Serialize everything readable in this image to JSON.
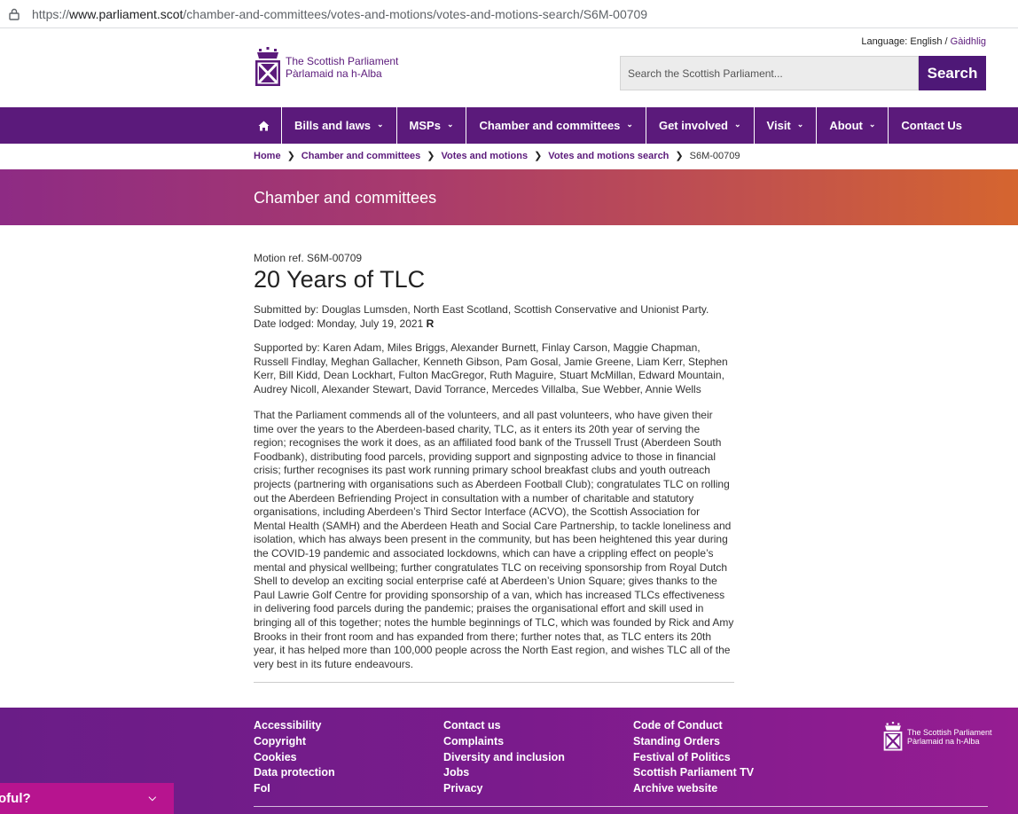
{
  "browser": {
    "url_prefix": "https://",
    "url_domain": "www.parliament.scot",
    "url_path": "/chamber-and-committees/votes-and-motions/votes-and-motions-search/S6M-00709"
  },
  "header": {
    "language_label": "Language:",
    "language_english": "English",
    "language_sep": " / ",
    "language_gaelic": "Gàidhlig",
    "logo_line1": "The Scottish Parliament",
    "logo_line2": "Pàrlamaid na h-Alba",
    "search_placeholder": "Search the Scottish Parliament...",
    "search_button": "Search"
  },
  "nav": {
    "items": [
      {
        "label": "Bills and laws"
      },
      {
        "label": "MSPs"
      },
      {
        "label": "Chamber and committees"
      },
      {
        "label": "Get involved"
      },
      {
        "label": "Visit"
      },
      {
        "label": "About"
      },
      {
        "label": "Contact Us"
      }
    ]
  },
  "breadcrumb": {
    "items": [
      "Home",
      "Chamber and committees",
      "Votes and motions",
      "Votes and motions search"
    ],
    "current": "S6M-00709"
  },
  "banner": {
    "title": "Chamber and committees"
  },
  "motion": {
    "ref": "Motion ref. S6M-00709",
    "title": "20 Years of TLC",
    "submitted_by": "Submitted by: Douglas Lumsden, North East Scotland, Scottish Conservative and Unionist Party.",
    "date_lodged": "Date lodged: Monday, July 19, 2021",
    "date_flag": "R",
    "supported_by": "Supported by: Karen Adam, Miles Briggs, Alexander Burnett, Finlay Carson, Maggie Chapman, Russell Findlay, Meghan Gallacher, Kenneth Gibson, Pam Gosal, Jamie Greene, Liam Kerr, Stephen Kerr, Bill Kidd, Dean Lockhart, Fulton MacGregor, Ruth Maguire, Stuart McMillan, Edward Mountain, Audrey Nicoll, Alexander Stewart, David Torrance, Mercedes Villalba, Sue Webber, Annie Wells",
    "text": "That the Parliament commends all of the volunteers, and all past volunteers, who have given their time over the years to the Aberdeen-based charity, TLC, as it enters its 20th year of serving the region; recognises the work it does, as an affiliated food bank of the Trussell Trust (Aberdeen South Foodbank), distributing food parcels, providing support and signposting advice to those in financial crisis; further recognises its past work running primary school breakfast clubs and youth outreach projects (partnering with organisations such as Aberdeen Football Club); congratulates TLC on rolling out the Aberdeen Befriending Project in consultation with a number of charitable and statutory organisations, including Aberdeen’s Third Sector Interface (ACVO), the Scottish Association for Mental Health (SAMH) and the Aberdeen Heath and Social Care Partnership, to tackle loneliness and isolation, which has always been present in the community, but has been heightened this year during the COVID-19 pandemic and associated lockdowns, which can have a crippling effect on people’s mental and physical wellbeing; further congratulates TLC on receiving sponsorship from Royal Dutch Shell to develop an exciting social enterprise café at Aberdeen’s Union Square; gives thanks to the Paul Lawrie Golf Centre for providing sponsorship of a van, which has increased TLCs effectiveness in delivering food parcels during the pandemic; praises the organisational effort and skill used in bringing all of this together; notes the humble beginnings of TLC, which was founded by Rick and Amy Brooks in their front room and has expanded from there; further notes that, as TLC enters its 20th year, it has helped more than 100,000 people across the North East region, and wishes TLC all of the very best in its future endeavours."
  },
  "footer": {
    "col1": [
      "Accessibility",
      "Copyright",
      "Cookies",
      "Data protection",
      "FoI"
    ],
    "col2": [
      "Contact us",
      "Complaints",
      "Diversity and inclusion",
      "Jobs",
      "Privacy"
    ],
    "col3": [
      "Code of Conduct",
      "Standing Orders",
      "Festival of Politics",
      "Scottish Parliament TV",
      "Archive website"
    ],
    "logo_line1": "The Scottish Parliament",
    "logo_line2": "Pàrlamaid na h-Alba"
  },
  "feedback": {
    "label": "oful?"
  },
  "colors": {
    "brand_purple": "#5b1a7b",
    "banner_start": "#8e2b84",
    "banner_end": "#d5652f",
    "feedback_pink": "#b7148f"
  }
}
